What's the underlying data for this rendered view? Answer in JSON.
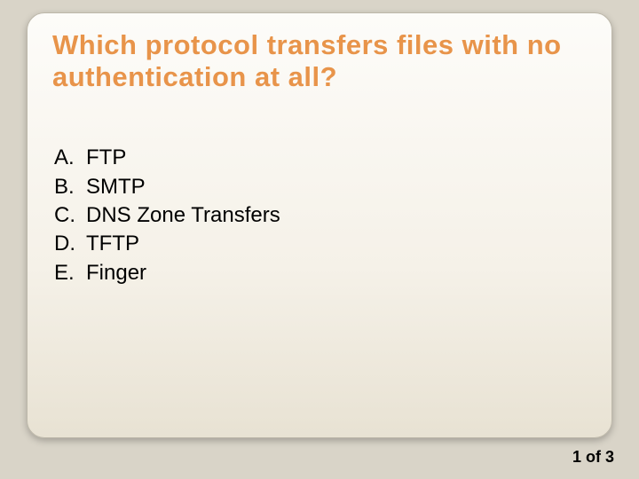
{
  "title": "Which protocol transfers files with no authentication at all?",
  "options": [
    {
      "letter": "A.",
      "text": "FTP"
    },
    {
      "letter": "B.",
      "text": "SMTP"
    },
    {
      "letter": "C.",
      "text": "DNS Zone Transfers"
    },
    {
      "letter": "D.",
      "text": "TFTP"
    },
    {
      "letter": "E.",
      "text": "Finger"
    }
  ],
  "pager": "1 of 3"
}
